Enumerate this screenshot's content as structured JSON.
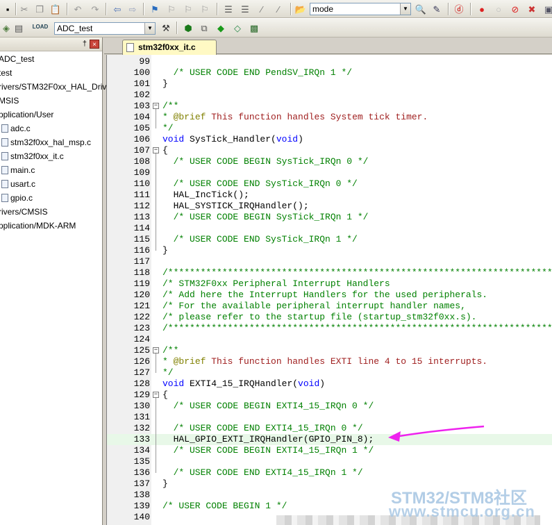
{
  "toolbar1": {
    "mode_value": "mode"
  },
  "toolbar2": {
    "target_value": "ADC_test"
  },
  "project_panel": {
    "pin_glyph": "†",
    "close_glyph": "×",
    "items": [
      {
        "label": "ADC_test",
        "type": "folder"
      },
      {
        "label": "test",
        "type": "folder"
      },
      {
        "label": "rivers/STM32F0xx_HAL_Driv",
        "type": "folder"
      },
      {
        "label": "MSIS",
        "type": "folder"
      },
      {
        "label": "pplication/User",
        "type": "folder"
      },
      {
        "label": "adc.c",
        "type": "file"
      },
      {
        "label": "stm32f0xx_hal_msp.c",
        "type": "file"
      },
      {
        "label": "stm32f0xx_it.c",
        "type": "file"
      },
      {
        "label": "main.c",
        "type": "file"
      },
      {
        "label": "usart.c",
        "type": "file"
      },
      {
        "label": "gpio.c",
        "type": "file"
      },
      {
        "label": "rivers/CMSIS",
        "type": "folder"
      },
      {
        "label": "pplication/MDK-ARM",
        "type": "folder"
      }
    ]
  },
  "editor": {
    "tab_label": "stm32f0xx_it.c",
    "lines": [
      {
        "n": "99",
        "text": "",
        "kind": "plain"
      },
      {
        "n": "100",
        "text": "  /* USER CODE END PendSV_IRQn 1 */",
        "kind": "comment"
      },
      {
        "n": "101",
        "text": "}",
        "kind": "plain"
      },
      {
        "n": "102",
        "text": "",
        "kind": "plain"
      },
      {
        "n": "103",
        "text": "/**",
        "kind": "comment",
        "fold": "-"
      },
      {
        "n": "104",
        "text": "* @brief This function handles System tick timer.",
        "kind": "doc"
      },
      {
        "n": "105",
        "text": "*/",
        "kind": "comment"
      },
      {
        "n": "106",
        "text": "void SysTick_Handler(void)",
        "kind": "func"
      },
      {
        "n": "107",
        "text": "{",
        "kind": "plain",
        "fold": "-"
      },
      {
        "n": "108",
        "text": "  /* USER CODE BEGIN SysTick_IRQn 0 */",
        "kind": "comment"
      },
      {
        "n": "109",
        "text": "",
        "kind": "plain"
      },
      {
        "n": "110",
        "text": "  /* USER CODE END SysTick_IRQn 0 */",
        "kind": "comment"
      },
      {
        "n": "111",
        "text": "  HAL_IncTick();",
        "kind": "plain"
      },
      {
        "n": "112",
        "text": "  HAL_SYSTICK_IRQHandler();",
        "kind": "plain"
      },
      {
        "n": "113",
        "text": "  /* USER CODE BEGIN SysTick_IRQn 1 */",
        "kind": "comment"
      },
      {
        "n": "114",
        "text": "",
        "kind": "plain"
      },
      {
        "n": "115",
        "text": "  /* USER CODE END SysTick_IRQn 1 */",
        "kind": "comment"
      },
      {
        "n": "116",
        "text": "}",
        "kind": "plain"
      },
      {
        "n": "117",
        "text": "",
        "kind": "plain"
      },
      {
        "n": "118",
        "text": "/******************************************************************************",
        "kind": "comment"
      },
      {
        "n": "119",
        "text": "/* STM32F0xx Peripheral Interrupt Handlers",
        "kind": "comment"
      },
      {
        "n": "120",
        "text": "/* Add here the Interrupt Handlers for the used peripherals.",
        "kind": "comment"
      },
      {
        "n": "121",
        "text": "/* For the available peripheral interrupt handler names,",
        "kind": "comment"
      },
      {
        "n": "122",
        "text": "/* please refer to the startup file (startup_stm32f0xx.s).",
        "kind": "comment"
      },
      {
        "n": "123",
        "text": "/******************************************************************************",
        "kind": "comment"
      },
      {
        "n": "124",
        "text": "",
        "kind": "plain"
      },
      {
        "n": "125",
        "text": "/**",
        "kind": "comment",
        "fold": "-"
      },
      {
        "n": "126",
        "text": "* @brief This function handles EXTI line 4 to 15 interrupts.",
        "kind": "doc"
      },
      {
        "n": "127",
        "text": "*/",
        "kind": "comment"
      },
      {
        "n": "128",
        "text": "void EXTI4_15_IRQHandler(void)",
        "kind": "func"
      },
      {
        "n": "129",
        "text": "{",
        "kind": "plain",
        "fold": "-"
      },
      {
        "n": "130",
        "text": "  /* USER CODE BEGIN EXTI4_15_IRQn 0 */",
        "kind": "comment"
      },
      {
        "n": "131",
        "text": "",
        "kind": "plain"
      },
      {
        "n": "132",
        "text": "  /* USER CODE END EXTI4_15_IRQn 0 */",
        "kind": "comment"
      },
      {
        "n": "133",
        "text": "  HAL_GPIO_EXTI_IRQHandler(GPIO_PIN_8);",
        "kind": "plain",
        "highlight": true
      },
      {
        "n": "134",
        "text": "  /* USER CODE BEGIN EXTI4_15_IRQn 1 */",
        "kind": "comment"
      },
      {
        "n": "135",
        "text": "",
        "kind": "plain"
      },
      {
        "n": "136",
        "text": "  /* USER CODE END EXTI4_15_IRQn 1 */",
        "kind": "comment"
      },
      {
        "n": "137",
        "text": "}",
        "kind": "plain"
      },
      {
        "n": "138",
        "text": "",
        "kind": "plain"
      },
      {
        "n": "139",
        "text": "/* USER CODE BEGIN 1 */",
        "kind": "comment"
      },
      {
        "n": "140",
        "text": "",
        "kind": "plain"
      }
    ]
  },
  "watermark": {
    "line1": "STM32/STM8社区",
    "line2": "www.stmcu.org.cn"
  },
  "colors": {
    "comment": "#008000",
    "keyword": "#0000ff",
    "annotation_arrow": "#ee22ee"
  }
}
